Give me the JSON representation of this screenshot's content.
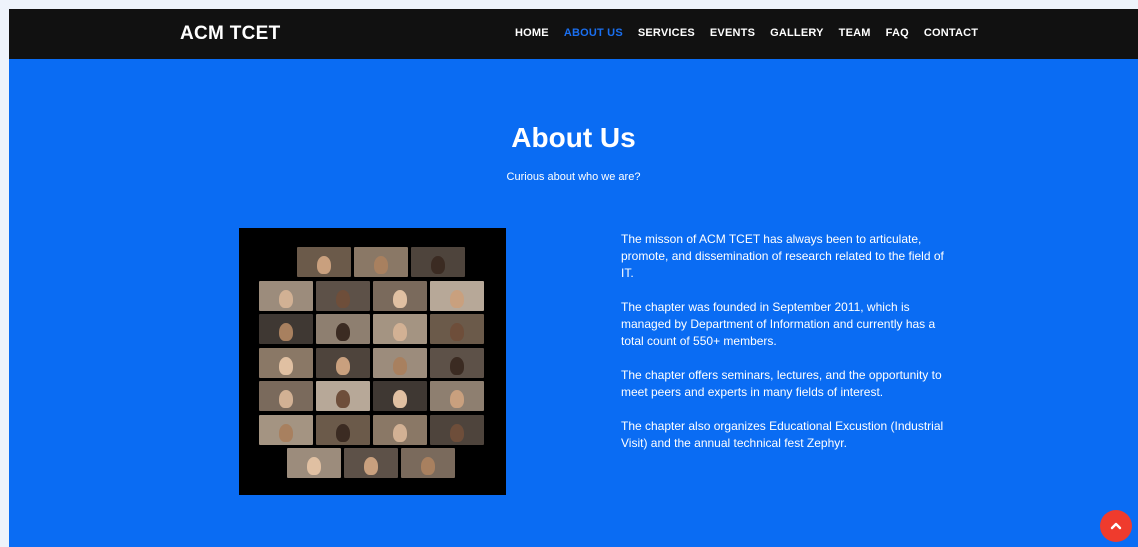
{
  "brand": "ACM TCET",
  "nav": [
    {
      "label": "HOME",
      "active": false
    },
    {
      "label": "ABOUT US",
      "active": true
    },
    {
      "label": "SERVICES",
      "active": false
    },
    {
      "label": "EVENTS",
      "active": false
    },
    {
      "label": "GALLERY",
      "active": false
    },
    {
      "label": "TEAM",
      "active": false
    },
    {
      "label": "FAQ",
      "active": false
    },
    {
      "label": "CONTACT",
      "active": false
    }
  ],
  "section": {
    "title": "About Us",
    "subtitle": "Curious about who we are?"
  },
  "paragraphs": [
    "The misson of ACM TCET has always been to articulate, promote, and dissemination of research related to the field of IT.",
    "The chapter was founded in September 2011, which is managed by Department of Information and currently has a total count of 550+ members.",
    "The chapter offers seminars, lectures, and the opportunity to meet peers and experts in many fields of interest.",
    "The chapter also organizes Educational Excustion (Industrial Visit) and the annual technical fest Zephyr."
  ],
  "icons": {
    "scroll_top": "chevron-up-icon"
  },
  "colors": {
    "navbar": "#111111",
    "section_bg": "#0a6cf3",
    "nav_active": "#1a6ff0",
    "scroll_top": "#ef3b2d"
  }
}
